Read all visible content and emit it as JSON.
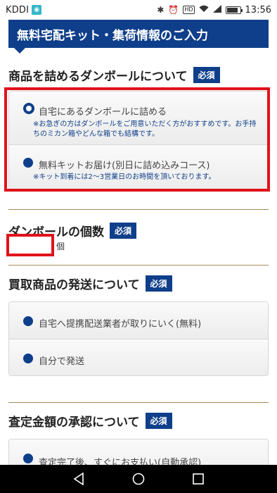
{
  "status_bar": {
    "carrier": "KDDI",
    "time": "13:56",
    "battery_level": 0.85,
    "icons": [
      "bluetooth-icon",
      "alarm-icon",
      "hd-icon",
      "wifi-icon",
      "signal-icon",
      "battery-icon"
    ]
  },
  "banner": {
    "title": "無料宅配キット・集荷情報のご入力"
  },
  "required_label": "必須",
  "box_section": {
    "title": "商品を詰めるダンボールについて",
    "options": [
      {
        "label": "自宅にあるダンボールに詰める",
        "note": "※お急ぎの方はダンボールをご用意いただく方がおすすめです。お手持ちのミカン箱やどんな箱でも結構です。",
        "selected": true
      },
      {
        "label": "無料キットお届け(別日に詰め込みコース)",
        "note": "※キット到着には2〜3営業日のお時間を頂いております。",
        "selected": false
      }
    ]
  },
  "count_section": {
    "title": "ダンボールの個数",
    "value": "",
    "unit": "個"
  },
  "shipping_section": {
    "title": "買取商品の発送について",
    "options": [
      {
        "label": "自宅へ提携配送業者が取りにいく(無料)"
      },
      {
        "label": "自分で発送"
      }
    ]
  },
  "approval_section": {
    "title": "査定金額の承認について",
    "options": [
      {
        "label": "査定完了後、すぐにお支払い(自動承認)"
      }
    ]
  },
  "colors": {
    "brand_navy": "#0f3f8a",
    "highlight_red": "#e0131b",
    "divider_gold": "#a58a5a"
  }
}
